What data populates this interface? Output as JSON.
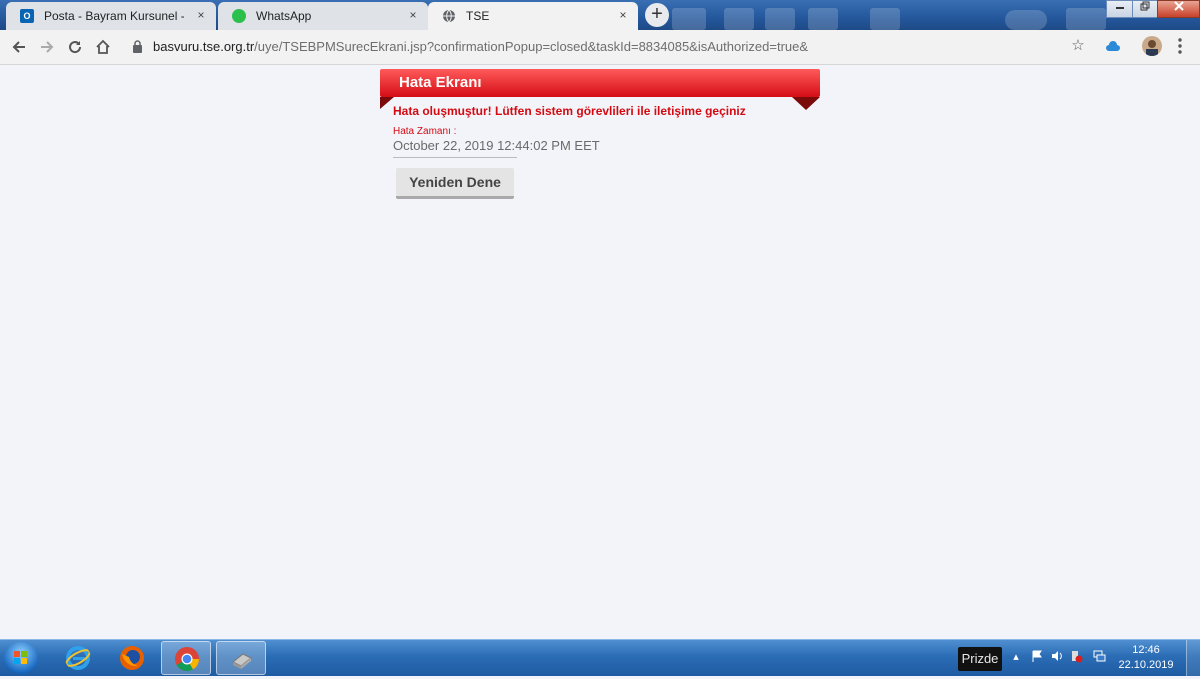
{
  "browser": {
    "tabs": [
      {
        "title": "Posta - Bayram Kursunel - Outlo",
        "icon": "outlook-icon",
        "active": false
      },
      {
        "title": "WhatsApp",
        "icon": "whatsapp-icon",
        "active": false
      },
      {
        "title": "TSE",
        "icon": "globe-icon",
        "active": true
      }
    ],
    "close_glyph": "×",
    "new_tab_glyph": "+",
    "url": {
      "host": "basvuru.tse.org.tr",
      "path": "/uye/TSEBPMSurecEkrani.jsp?confirmationPopup=closed&taskId=8834085&isAuthorized=true&"
    }
  },
  "page": {
    "header_title": "Hata Ekranı",
    "error_message": "Hata oluşmuştur! Lütfen sistem görevlileri ile iletişime geçiniz",
    "time_label": "Hata Zamanı :",
    "time_value": "October 22, 2019 12:44:02 PM EET",
    "retry_label": "Yeniden Dene"
  },
  "taskbar": {
    "language": "Prizde",
    "time": "12:46",
    "date": "22.10.2019"
  },
  "colors": {
    "header_red": "#e4151d",
    "error_text": "#d40a12",
    "page_bg": "#f2f4f9"
  }
}
